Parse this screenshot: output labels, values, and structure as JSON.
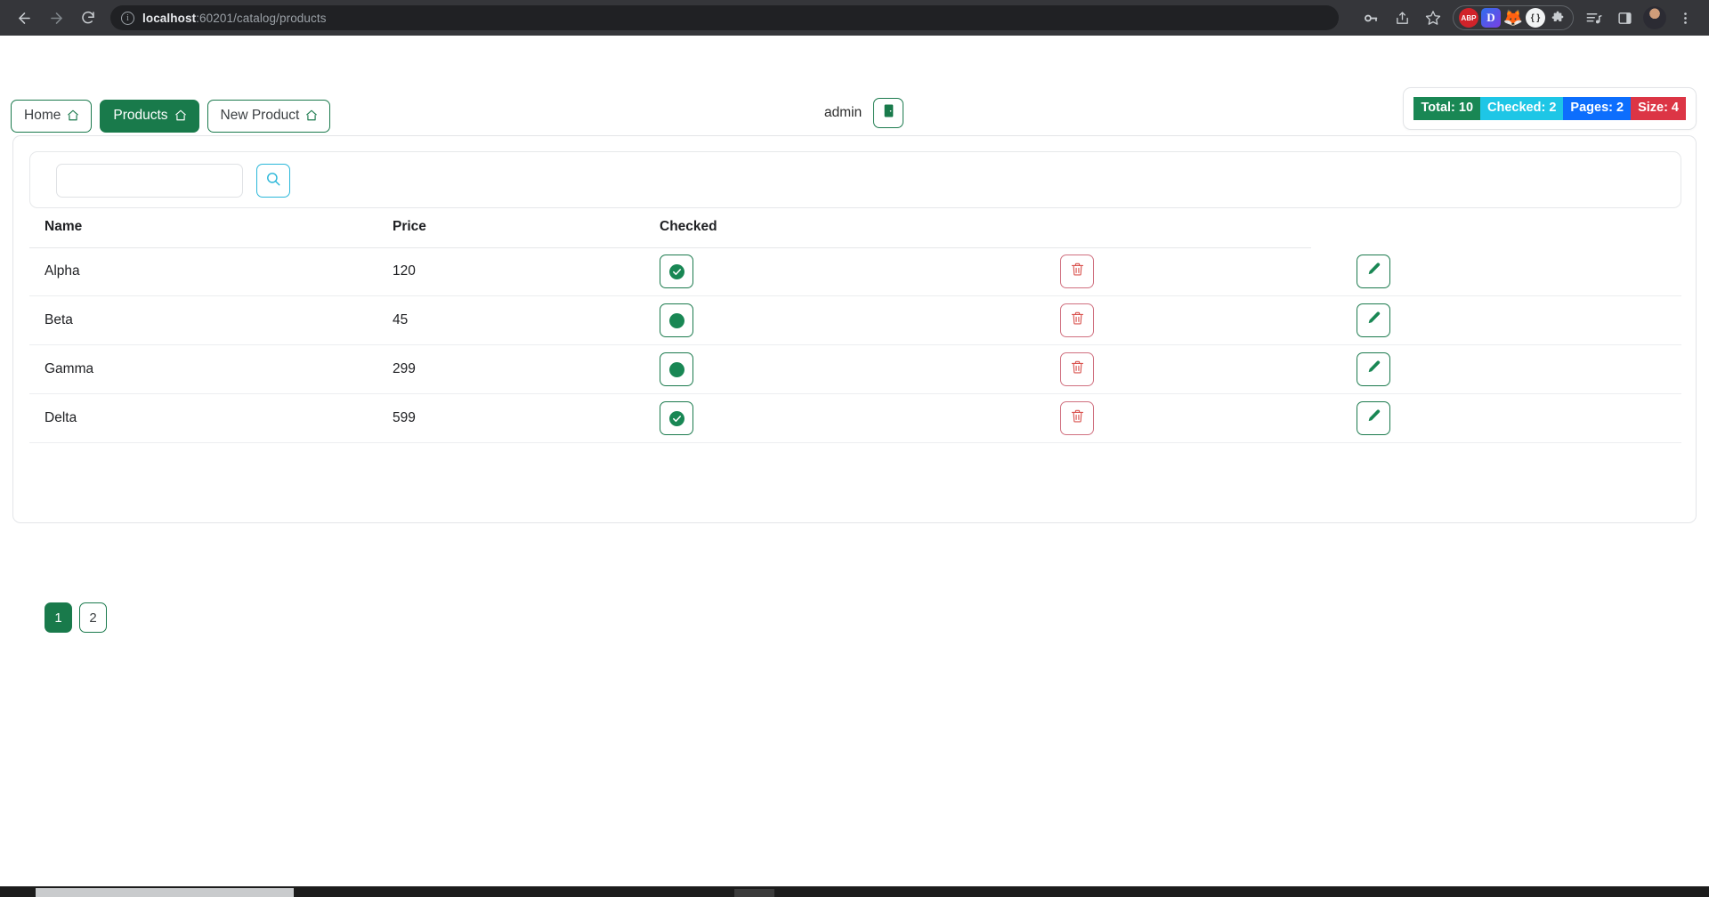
{
  "browser": {
    "back_icon": "back-arrow-icon",
    "forward_icon": "forward-arrow-icon",
    "reload_icon": "reload-icon",
    "url_host": "localhost",
    "url_path": ":60201/catalog/products",
    "url_full": "localhost:60201/catalog/products",
    "site_info_icon": "info-circle-icon",
    "extensions": [
      {
        "name": "adblock-plus",
        "label": "ABP"
      },
      {
        "name": "dashlane",
        "label": "D"
      },
      {
        "name": "firefox-relay",
        "label": "🦊"
      },
      {
        "name": "code-brackets",
        "label": "{ }"
      },
      {
        "name": "extensions-puzzle",
        "label": "❖"
      }
    ],
    "toolbar_icons": [
      "key-icon",
      "share-icon",
      "star-icon",
      "playlist-icon",
      "sidebar-icon",
      "avatar",
      "kebab-menu-icon"
    ]
  },
  "header": {
    "nav": [
      {
        "label": "Home",
        "active": false,
        "icon": "house-icon"
      },
      {
        "label": "Products",
        "active": true,
        "icon": "house-icon"
      },
      {
        "label": "New Product",
        "active": false,
        "icon": "house-icon"
      }
    ],
    "user": {
      "name": "admin",
      "logout_icon": "logout-door-icon"
    },
    "stats": [
      {
        "key": "total",
        "label": "Total: 10",
        "color": "#198754"
      },
      {
        "key": "checked",
        "label": "Checked: 2",
        "color": "#1ec6e6"
      },
      {
        "key": "pages",
        "label": "Pages: 2",
        "color": "#0d6efd"
      },
      {
        "key": "size",
        "label": "Size: 4",
        "color": "#dc3545"
      }
    ]
  },
  "search": {
    "value": "",
    "placeholder": "",
    "button_icon": "search-icon"
  },
  "table": {
    "columns": [
      "Name",
      "Price",
      "Checked",
      "",
      ""
    ],
    "rows": [
      {
        "name": "Alpha",
        "price": "120",
        "checked": true,
        "delete_icon": "trash-icon",
        "edit_icon": "pencil-icon"
      },
      {
        "name": "Beta",
        "price": "45",
        "checked": false,
        "delete_icon": "trash-icon",
        "edit_icon": "pencil-icon"
      },
      {
        "name": "Gamma",
        "price": "299",
        "checked": false,
        "delete_icon": "trash-icon",
        "edit_icon": "pencil-icon"
      },
      {
        "name": "Delta",
        "price": "599",
        "checked": true,
        "delete_icon": "trash-icon",
        "edit_icon": "pencil-icon"
      }
    ]
  },
  "pagination": {
    "pages": [
      {
        "label": "1",
        "active": true
      },
      {
        "label": "2",
        "active": false
      }
    ]
  }
}
